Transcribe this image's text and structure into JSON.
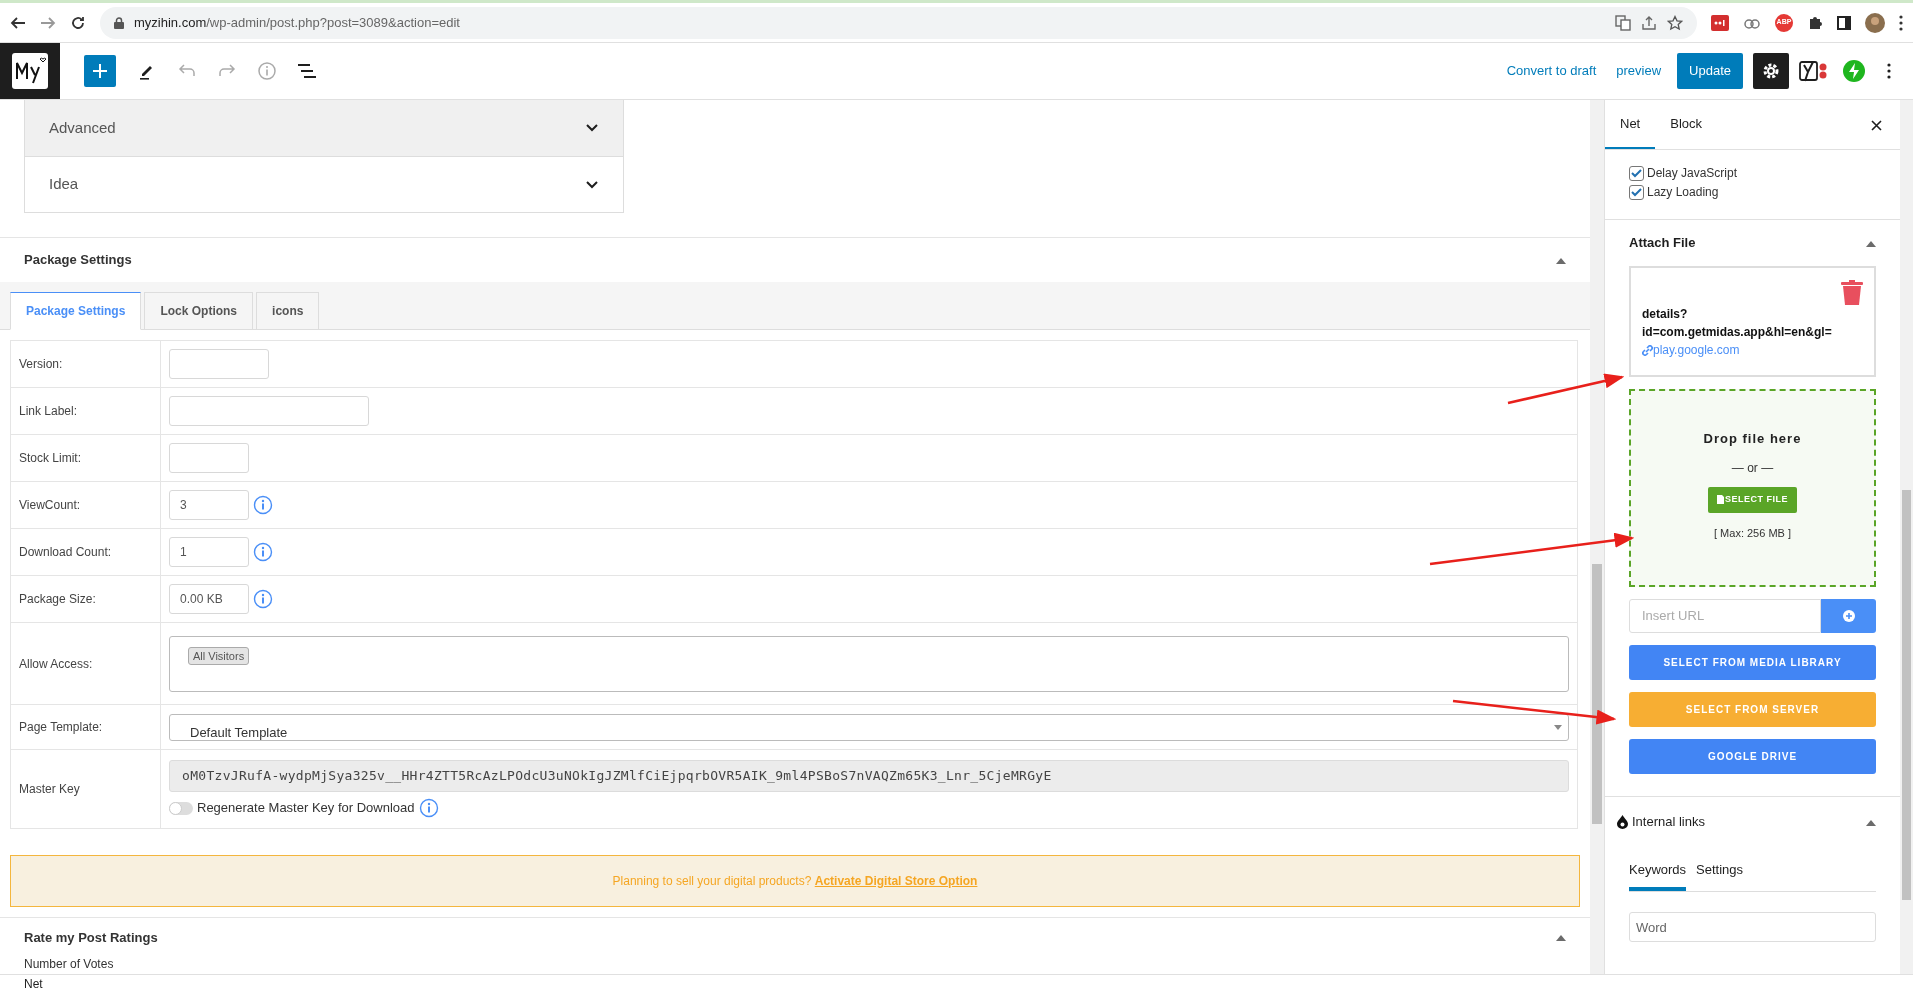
{
  "browser": {
    "url_host": "myzihin.com",
    "url_path": "/wp-admin/post.php?post=3089&action=edit",
    "adblock_label": "ABP"
  },
  "toolbar": {
    "convert_label": "Convert to draft",
    "preview_label": "preview",
    "update_label": "Update"
  },
  "accordion": [
    {
      "label": "Advanced",
      "highlighted": true
    },
    {
      "label": "Idea",
      "highlighted": false
    }
  ],
  "package_settings": {
    "title": "Package Settings",
    "expanded": true,
    "tabs": [
      {
        "label": "Package Settings",
        "selected": true
      },
      {
        "label": "Lock Options",
        "selected": false
      },
      {
        "label": "icons",
        "selected": false
      }
    ],
    "rows": [
      {
        "kind": "field",
        "label": "Version:",
        "value": "",
        "info": false
      },
      {
        "kind": "field",
        "label": "Link Label:",
        "value": "",
        "info": false
      },
      {
        "kind": "field",
        "label": "Stock Limit:",
        "value": "",
        "info": false
      },
      {
        "kind": "field",
        "label": "ViewCount:",
        "value": "3",
        "info": true
      },
      {
        "kind": "field",
        "label": "Download Count:",
        "value": "1",
        "info": true
      },
      {
        "kind": "field",
        "label": "Package Size:",
        "value": "0.00 KB",
        "info": true
      },
      {
        "kind": "tags",
        "label": "Allow Access:",
        "tags": [
          "All Visitors"
        ]
      },
      {
        "kind": "select",
        "label": "Page Template:",
        "value": "Default Template"
      },
      {
        "kind": "key",
        "label": "Master Key",
        "value": "oM0TzvJRufA-wydpMjSya325v__HHr4ZTT5RcAzLPOdcU3uNOkIgJZMlfCiEjpqrbOVR5AIK_9ml4PSBoS7nVAQZm65K3_Lnr_5CjeMRGyE",
        "toggle_label": "Regenerate Master Key for Download",
        "toggle_on": false
      }
    ]
  },
  "notice": {
    "text": "Planning to sell your digital products?",
    "link": "Activate Digital Store Option"
  },
  "ratings": {
    "title": "Rate my Post Ratings",
    "expanded": true,
    "label": "Number of Votes"
  },
  "sidebar": {
    "tabs": [
      {
        "label": "Net",
        "selected": true
      },
      {
        "label": "Block",
        "selected": false
      }
    ],
    "checkboxes": [
      {
        "label": "Delay JavaScript",
        "checked": true
      },
      {
        "label": "Lazy Loading",
        "checked": true
      }
    ],
    "attach": {
      "title": "Attach File",
      "expanded": true,
      "file_name": "details?\nid=com.getmidas.app&hl=en&gl=",
      "file_link": "play.google.com",
      "drop_title": "Drop file here",
      "drop_or": "— or —",
      "select_label": "SELECT FILE",
      "max_label": "[ Max: 256 MB ]",
      "url_placeholder": "Insert URL",
      "buttons": [
        {
          "label": "SELECT FROM MEDIA LIBRARY",
          "color": "#4285f4"
        },
        {
          "label": "SELECT FROM SERVER",
          "color": "#f7ae33"
        },
        {
          "label": "GOOGLE DRIVE",
          "color": "#4285f4"
        }
      ]
    },
    "links": {
      "title": "Internal links",
      "expanded": true,
      "tabs": [
        {
          "label": "Keywords",
          "selected": true
        },
        {
          "label": "Settings",
          "selected": false
        }
      ],
      "placeholder": "Word"
    }
  },
  "footer": {
    "label": "Net"
  }
}
